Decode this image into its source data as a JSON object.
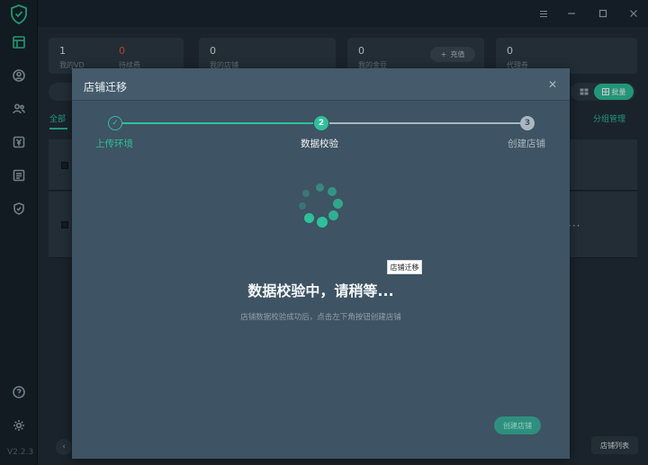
{
  "app": {
    "version": "V2.2.3",
    "window_controls": [
      "menu-icon",
      "minimize-icon",
      "maximize-icon",
      "close-icon"
    ]
  },
  "sidebar": {
    "icons": [
      "dashboard-icon",
      "user-circle-icon",
      "users-icon",
      "yen-icon",
      "list-icon",
      "shield-check-icon"
    ],
    "bottom_icons": [
      "help-icon",
      "settings-icon"
    ]
  },
  "stats": [
    {
      "value": "1",
      "label": "我的VD",
      "value2": "0",
      "label2": "待续费"
    },
    {
      "value": "0",
      "label": "我的店铺"
    },
    {
      "value": "0",
      "label": "我的金豆",
      "action": "充值"
    },
    {
      "value": "0",
      "label": "代理券"
    }
  ],
  "toolbar": {
    "batch_label": "批量"
  },
  "tabs": {
    "all": "全部",
    "group_manage": "分组管理"
  },
  "footer": {
    "shop_list": "店铺列表"
  },
  "modal": {
    "title": "店铺迁移",
    "steps": [
      {
        "index": "✓",
        "label": "上传环境",
        "state": "done"
      },
      {
        "index": "2",
        "label": "数据校验",
        "state": "active"
      },
      {
        "index": "3",
        "label": "创建店铺",
        "state": "pending"
      }
    ],
    "tooltip": "店铺迁移",
    "wait_text": "数据校验中，请稍等...",
    "hint_text": "店铺数据校验成功后，点击左下角按钮创建店铺",
    "create_button": "创建店铺"
  },
  "colors": {
    "accent": "#2ec09a",
    "warning": "#e35b2b",
    "modal_bg": "#3e5363"
  }
}
